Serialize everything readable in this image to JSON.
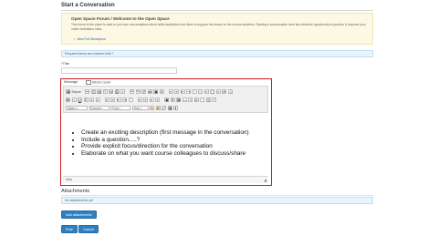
{
  "page": {
    "title": "Start a Conversation"
  },
  "forum": {
    "title": "Open Space Forum / Welcome to the Open Space",
    "description": "This forum is the place to start or join new conversations about skills facilitation that dives to support the lesson in the course activities. Starting a conversation here lets students opportunity to practice & improve your online facilitation skills.",
    "link": "View Full Description"
  },
  "notices": {
    "required": "Required items are marked with",
    "required_star": "*",
    "no_attachments": "No attachments yet"
  },
  "form": {
    "title_label": "Title",
    "title_star": "*",
    "title_value": ""
  },
  "editor": {
    "tab_message": "Message",
    "tab_wordcount": "Word Count",
    "toolbar": {
      "source_label": "Source",
      "style_select": "Styles",
      "format_select": "Format",
      "font_select": "Font",
      "size_select": "Size"
    },
    "content": [
      "Create an exciting description (first message in the conversation)",
      "Include a question.....?",
      "Provide explicit focus/direction for the conversation",
      "Elaborate on what you want course colleagues to discuss/share"
    ],
    "status_path": "body"
  },
  "attachments": {
    "heading": "Attachments",
    "add_button": "Add attachments"
  },
  "actions": {
    "post": "Post",
    "cancel": "Cancel"
  },
  "colors": {
    "editor_border": "#c91b22",
    "button_blue": "#2f7fbf",
    "notice_bg": "#e8f4fb",
    "forum_bg": "#fcf8e3"
  },
  "icons": [
    "bold-icon",
    "italic-icon",
    "underline-icon",
    "strike-icon",
    "link-icon",
    "image-icon",
    "table-icon",
    "resize-grip-icon"
  ]
}
